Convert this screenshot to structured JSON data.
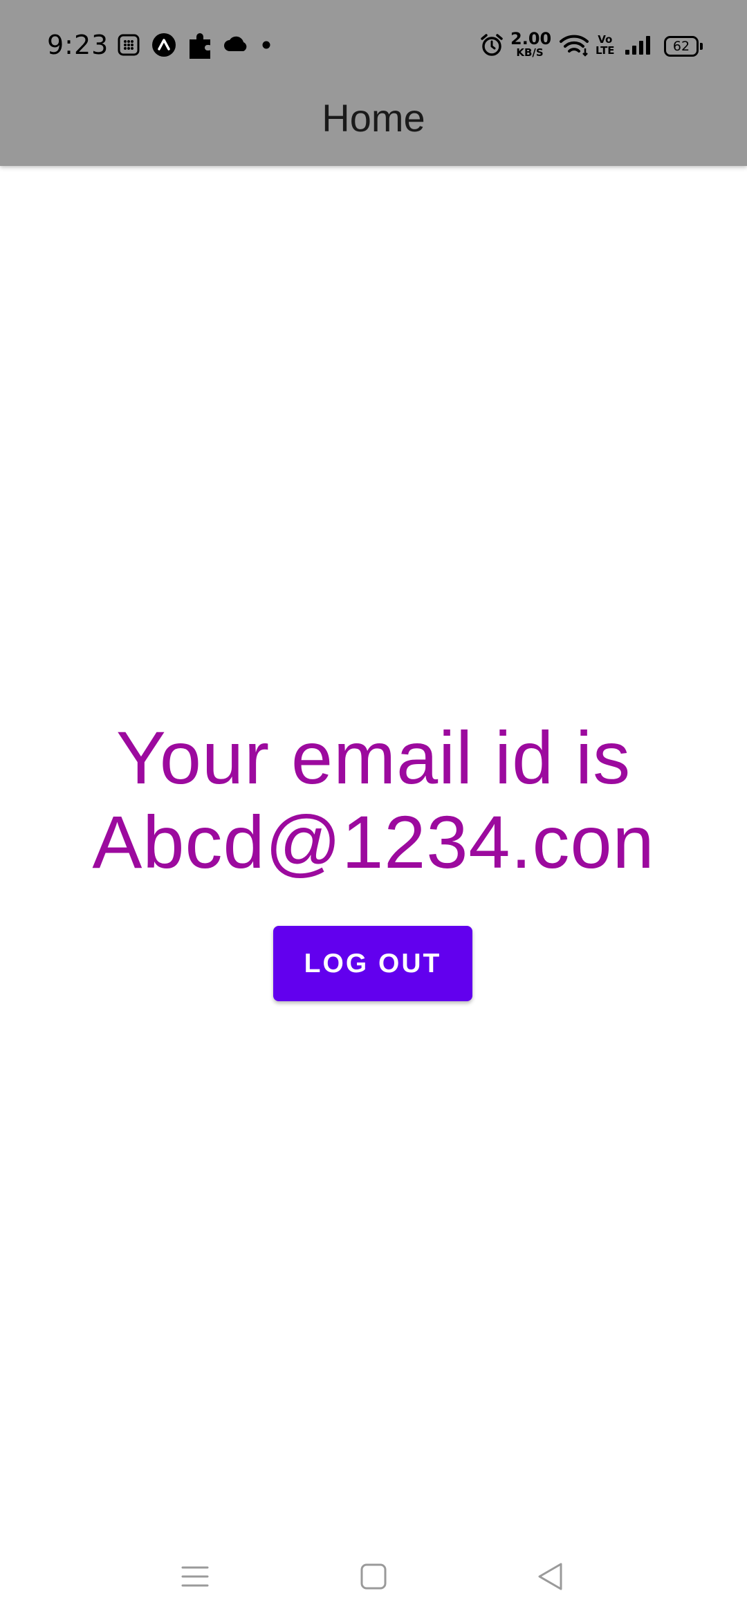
{
  "status_bar": {
    "time": "9:23",
    "net_speed_value": "2.00",
    "net_speed_unit": "KB/S",
    "volte_line1": "Vo",
    "volte_line2": "LTE",
    "battery_level": "62",
    "left_icons": [
      "calculator-icon",
      "app-launcher-icon",
      "puzzle-icon",
      "cloud-icon",
      "notification-dot-icon"
    ],
    "right_icons": [
      "alarm-icon",
      "wifi-icon",
      "signal-icon",
      "battery-icon"
    ]
  },
  "app_bar": {
    "title": "Home"
  },
  "main": {
    "email_line1": "Your email id is",
    "email_line2": "Abcd@1234.con",
    "text_color": "#9c0a9e",
    "logout_label": "LOG OUT",
    "button_color": "#6200ee"
  },
  "nav_bar": {
    "buttons": [
      "menu-icon",
      "home-icon",
      "back-icon"
    ]
  }
}
